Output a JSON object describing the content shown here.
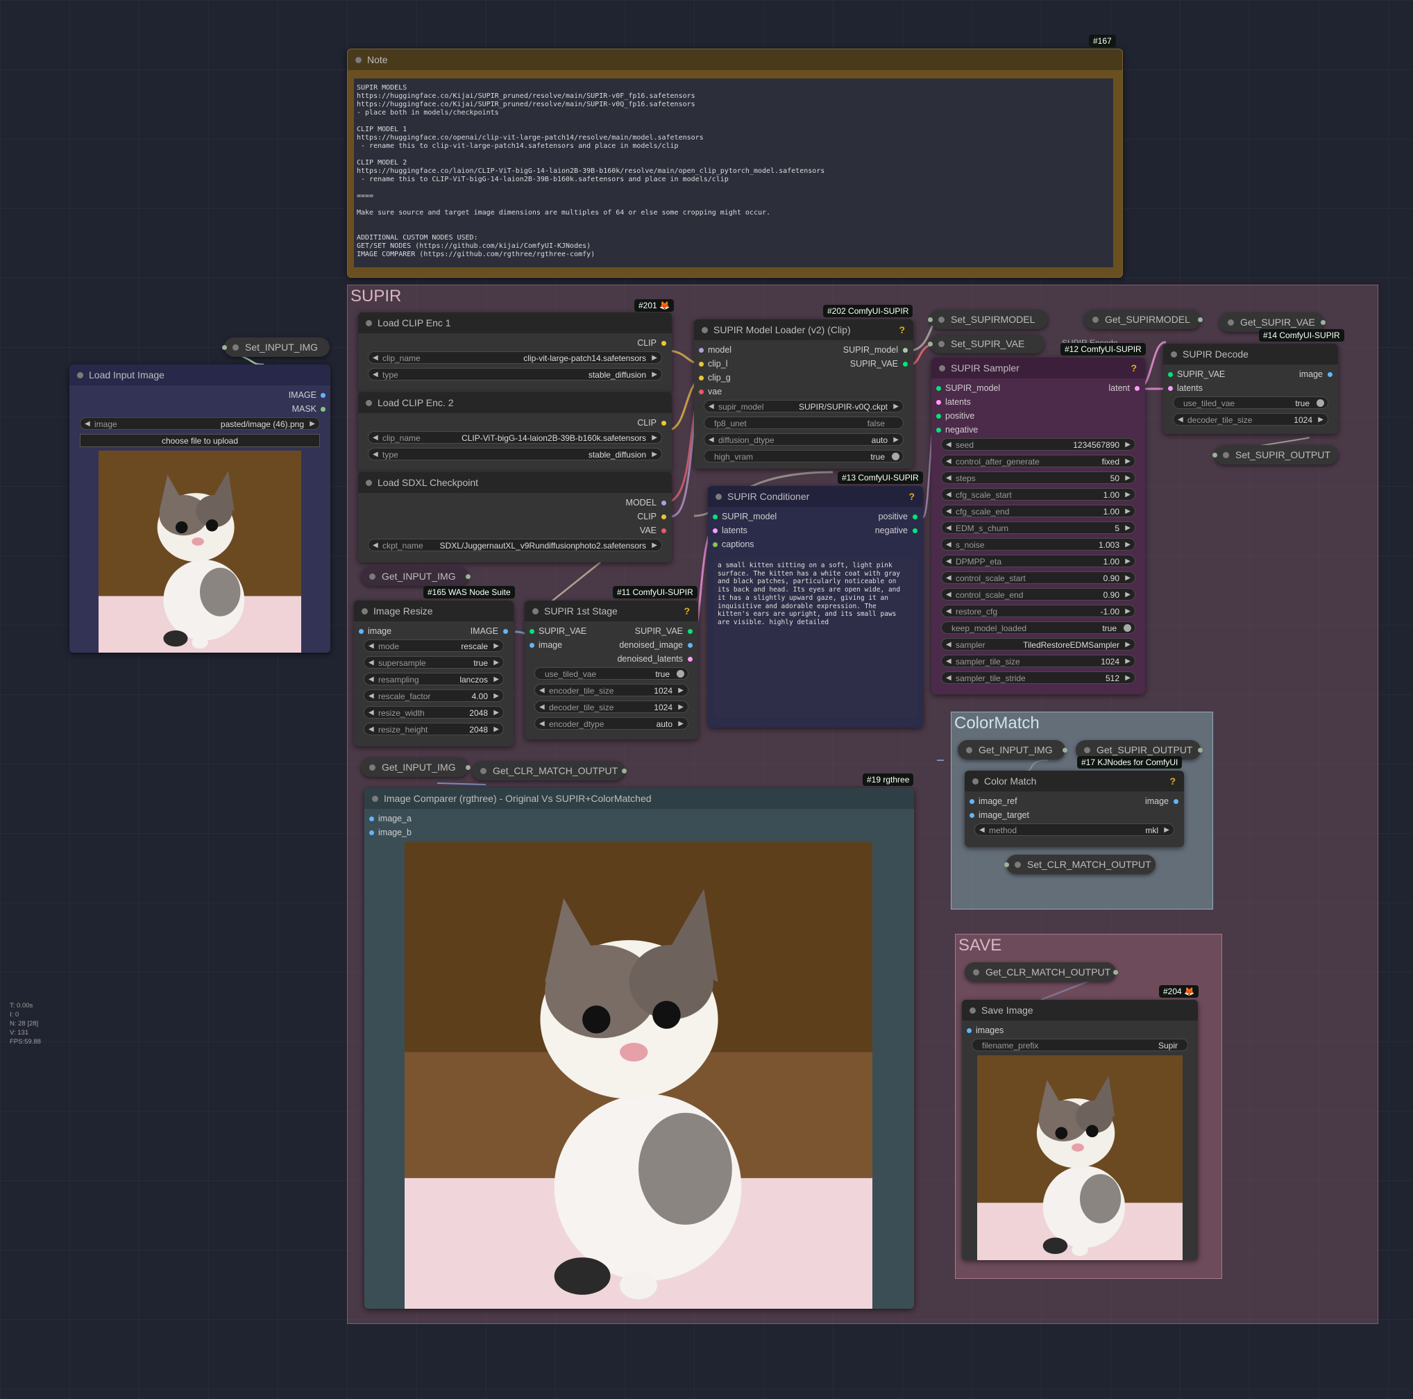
{
  "groups": {
    "supir": "SUPIR",
    "colormatch": "ColorMatch",
    "save": "SAVE"
  },
  "note": {
    "title": "Note",
    "badge": "#167",
    "text": "SUPIR MODELS\nhttps://huggingface.co/Kijai/SUPIR_pruned/resolve/main/SUPIR-v0F_fp16.safetensors\nhttps://huggingface.co/Kijai/SUPIR_pruned/resolve/main/SUPIR-v0Q_fp16.safetensors\n- place both in models/checkpoints\n\nCLIP MODEL 1\nhttps://huggingface.co/openai/clip-vit-large-patch14/resolve/main/model.safetensors\n - rename this to clip-vit-large-patch14.safetensors and place in models/clip\n\nCLIP MODEL 2\nhttps://huggingface.co/laion/CLIP-ViT-bigG-14-laion2B-39B-b160k/resolve/main/open_clip_pytorch_model.safetensors\n - rename this to CLIP-ViT-bigG-14-laion2B-39B-b160k.safetensors and place in models/clip\n\n====\n\nMake sure source and target image dimensions are multiples of 64 or else some cropping might occur.\n\n\nADDITIONAL CUSTOM NODES USED:\nGET/SET NODES (https://github.com/kijai/ComfyUI-KJNodes)\nIMAGE COMPARER (https://github.com/rgthree/rgthree-comfy)"
  },
  "load_input_image": {
    "title": "Load Input Image",
    "out_image": "IMAGE",
    "out_mask": "MASK",
    "image_label": "image",
    "image_value": "pasted/image (46).png",
    "upload_button": "choose file to upload"
  },
  "set_input_img": "Set_INPUT_IMG",
  "load_clip1": {
    "title": "Load CLIP Enc 1",
    "badge": "#201 🦊",
    "out": "CLIP",
    "clip_name_label": "clip_name",
    "clip_name_value": "clip-vit-large-patch14.safetensors",
    "type_label": "type",
    "type_value": "stable_diffusion"
  },
  "load_clip2": {
    "title": "Load CLIP Enc. 2",
    "out": "CLIP",
    "clip_name_label": "clip_name",
    "clip_name_value": "CLIP-ViT-bigG-14-laion2B-39B-b160k.safetensors",
    "type_label": "type",
    "type_value": "stable_diffusion"
  },
  "load_sdxl": {
    "title": "Load SDXL Checkpoint",
    "out_model": "MODEL",
    "out_clip": "CLIP",
    "out_vae": "VAE",
    "ckpt_label": "ckpt_name",
    "ckpt_value": "SDXL/JuggernautXL_v9Rundiffusionphoto2.safetensors"
  },
  "get_input_img_1": "Get_INPUT_IMG",
  "image_resize": {
    "title": "Image Resize",
    "badge": "#165 WAS Node Suite",
    "in_image": "image",
    "out_image": "IMAGE",
    "widgets": [
      {
        "label": "mode",
        "value": "rescale"
      },
      {
        "label": "supersample",
        "value": "true"
      },
      {
        "label": "resampling",
        "value": "lanczos"
      },
      {
        "label": "rescale_factor",
        "value": "4.00"
      },
      {
        "label": "resize_width",
        "value": "2048"
      },
      {
        "label": "resize_height",
        "value": "2048"
      }
    ]
  },
  "first_stage": {
    "title": "SUPIR 1st Stage",
    "badge": "#11 ComfyUI-SUPIR",
    "q": "?",
    "in_vae": "SUPIR_VAE",
    "in_image": "image",
    "out_vae": "SUPIR_VAE",
    "out_denoised_image": "denoised_image",
    "out_denoised_latents": "denoised_latents",
    "toggle_label": "use_tiled_vae",
    "toggle_value": "true",
    "widgets": [
      {
        "label": "encoder_tile_size",
        "value": "1024"
      },
      {
        "label": "decoder_tile_size",
        "value": "1024"
      },
      {
        "label": "encoder_dtype",
        "value": "auto"
      }
    ]
  },
  "model_loader": {
    "title": "SUPIR Model Loader (v2) (Clip)",
    "badge": "#202 ComfyUI-SUPIR",
    "q": "?",
    "in_model": "model",
    "in_clip_l": "clip_l",
    "in_clip_g": "clip_g",
    "in_vae": "vae",
    "out_model": "SUPIR_model",
    "out_vae": "SUPIR_VAE",
    "supir_model_label": "supir_model",
    "supir_model_value": "SUPIR/SUPIR-v0Q.ckpt",
    "fp8_label": "fp8_unet",
    "fp8_value": "false",
    "dtype_label": "diffusion_dtype",
    "dtype_value": "auto",
    "vram_label": "high_vram",
    "vram_value": "true"
  },
  "conditioner": {
    "title": "SUPIR Conditioner",
    "badge": "#13 ComfyUI-SUPIR",
    "q": "?",
    "in_model": "SUPIR_model",
    "in_latents": "latents",
    "in_captions": "captions",
    "out_positive": "positive",
    "out_negative": "negative",
    "prompt": "a small kitten sitting on a soft, light pink\nsurface. The kitten has a white coat with gray\nand black patches, particularly noticeable on\nits back and head. Its eyes are open wide, and\nit has a slightly upward gaze, giving it an\ninquisitive and adorable expression. The\nkitten's ears are upright, and its small paws\nare visible. highly detailed"
  },
  "set_supirmodel": "Set_SUPIRMODEL",
  "set_supir_vae": "Set_SUPIR_VAE",
  "get_supirmodel": "Get_SUPIRMODEL",
  "get_supir_vae": "Get_SUPIR_VAE",
  "supir_encode_hidden": "SUPIR Encode",
  "sampler": {
    "title": "SUPIR Sampler",
    "badge": "#12 ComfyUI-SUPIR",
    "q": "?",
    "in_model": "SUPIR_model",
    "in_latents": "latents",
    "in_positive": "positive",
    "in_negative": "negative",
    "out_latent": "latent",
    "widgets": [
      {
        "label": "seed",
        "value": "1234567890"
      },
      {
        "label": "control_after_generate",
        "value": "fixed"
      },
      {
        "label": "steps",
        "value": "50"
      },
      {
        "label": "cfg_scale_start",
        "value": "1.00"
      },
      {
        "label": "cfg_scale_end",
        "value": "1.00"
      },
      {
        "label": "EDM_s_churn",
        "value": "5"
      },
      {
        "label": "s_noise",
        "value": "1.003"
      },
      {
        "label": "DPMPP_eta",
        "value": "1.00"
      },
      {
        "label": "control_scale_start",
        "value": "0.90"
      },
      {
        "label": "control_scale_end",
        "value": "0.90"
      },
      {
        "label": "restore_cfg",
        "value": "-1.00"
      }
    ],
    "keep_label": "keep_model_loaded",
    "keep_value": "true",
    "widgets2": [
      {
        "label": "sampler",
        "value": "TiledRestoreEDMSampler"
      },
      {
        "label": "sampler_tile_size",
        "value": "1024"
      },
      {
        "label": "sampler_tile_stride",
        "value": "512"
      }
    ]
  },
  "decode": {
    "title": "SUPIR Decode",
    "badge": "#14 ComfyUI-SUPIR",
    "in_vae": "SUPIR_VAE",
    "in_latents": "latents",
    "out_image": "image",
    "toggle_label": "use_tiled_vae",
    "toggle_value": "true",
    "tile_label": "decoder_tile_size",
    "tile_value": "1024"
  },
  "set_supir_output": "Set_SUPIR_OUTPUT",
  "get_input_img_2": "Get_INPUT_IMG",
  "get_clr_match_output_1": "Get_CLR_MATCH_OUTPUT",
  "comparer": {
    "title": "Image Comparer (rgthree) - Original Vs SUPIR+ColorMatched",
    "badge": "#19 rgthree",
    "in_a": "image_a",
    "in_b": "image_b"
  },
  "get_input_img_3": "Get_INPUT_IMG",
  "get_supir_output": "Get_SUPIR_OUTPUT",
  "color_match": {
    "title": "Color Match",
    "badge": "#17 KJNodes for ComfyUI",
    "q": "?",
    "in_ref": "image_ref",
    "in_target": "image_target",
    "out_image": "image",
    "method_label": "method",
    "method_value": "mkl"
  },
  "set_clr_match_output": "Set_CLR_MATCH_OUTPUT",
  "get_clr_match_output_2": "Get_CLR_MATCH_OUTPUT",
  "save_image": {
    "title": "Save Image",
    "badge": "#204 🦊",
    "in_images": "images",
    "prefix_label": "filename_prefix",
    "prefix_value": "Supir"
  },
  "stats": {
    "t": "T: 0.00s",
    "i": "I: 0",
    "n": "N: 28 [28]",
    "v": "V: 131",
    "fps": "FPS:59.88"
  },
  "colors": {
    "supir_group": "#8a5b6b",
    "colormatch_group": "#7a9aa3",
    "save_group": "#8a5b6b",
    "note_border": "#7a6230",
    "wire_clip": "#e8c832",
    "wire_vae": "#e85a6a",
    "wire_image": "#64b5f6",
    "wire_latent": "#ff9cf9",
    "wire_model": "#b39ddb",
    "wire_generic": "#a8c8a8"
  }
}
